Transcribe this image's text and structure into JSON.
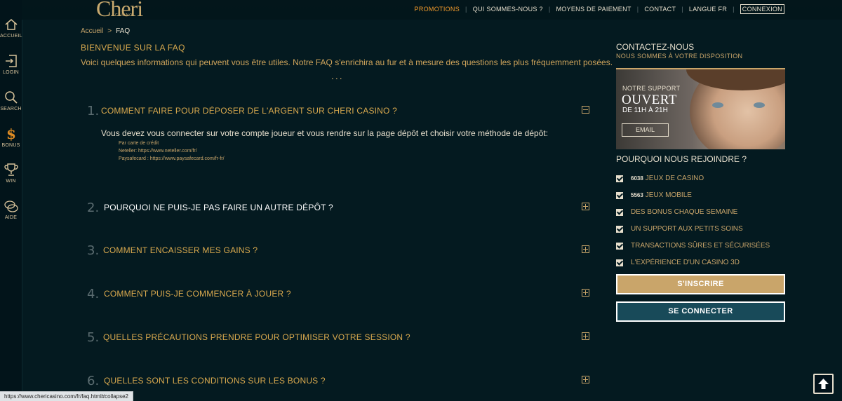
{
  "leftnav": [
    {
      "label": "ACCUEIL",
      "icon": "home-icon"
    },
    {
      "label": "LOGIN",
      "icon": "login-icon"
    },
    {
      "label": "SEARCH",
      "icon": "search-icon"
    },
    {
      "label": "BONUS",
      "icon": "dollar-icon"
    },
    {
      "label": "WIN",
      "icon": "trophy-icon"
    },
    {
      "label": "AIDE",
      "icon": "chat-bubbles-icon"
    }
  ],
  "brand": {
    "name": "Cheri",
    "sub": "CASINO"
  },
  "topnav": {
    "promotions": "PROMOTIONS",
    "about": "QUI SOMMES-NOUS ?",
    "payment": "MOYENS DE PAIEMENT",
    "contact": "CONTACT",
    "language": "LANGUE FR",
    "login": "CONNEXION"
  },
  "breadcrumb": {
    "home": "Accueil",
    "separator": ">",
    "current": "FAQ"
  },
  "intro": {
    "title": "BIENVENUE SUR LA FAQ",
    "text": "Voici quelques informations qui peuvent vous être utiles. Notre FAQ s'enrichira au fur et à mesure des questions les plus fréquemment posées.",
    "dots": "..."
  },
  "faq": [
    {
      "num": "1.",
      "question": "COMMENT FAIRE POUR DÉPOSER DE L'ARGENT SUR CHERI CASINO ?",
      "expanded": true
    },
    {
      "num": "2.",
      "question": "POURQUOI NE PUIS-JE PAS FAIRE UN AUTRE DÉPÔT ?",
      "expanded": false
    },
    {
      "num": "3.",
      "question": "COMMENT ENCAISSER MES GAINS ?",
      "expanded": false
    },
    {
      "num": "4.",
      "question": "COMMENT PUIS-JE COMMENCER À JOUER ?",
      "expanded": false
    },
    {
      "num": "5.",
      "question": "QUELLES PRÉCAUTIONS PRENDRE POUR OPTIMISER VOTRE SESSION ?",
      "expanded": false
    },
    {
      "num": "6.",
      "question": "QUELLES SONT LES CONDITIONS SUR LES BONUS ?",
      "expanded": false
    }
  ],
  "answer1": {
    "intro": "Vous devez vous connecter sur votre compte joueur et vous rendre sur la page dépôt et choisir votre méthode de dépôt:",
    "options": [
      "Par carte de crédit",
      "Neteller: https://www.neteller.com/fr/",
      "Paysafecard : https://www.paysafecard.com/fr-fr/"
    ]
  },
  "contact": {
    "title": "CONTACTEZ-NOUS",
    "subtitle": "NOUS SOMMES À VOTRE DISPOSITION",
    "support_label": "NOTRE SUPPORT",
    "status": "OUVERT",
    "hours": "DE 11H À 21H",
    "email_button": "EMAIL"
  },
  "why": {
    "title": "POURQUOI NOUS REJOINDRE ?",
    "items": [
      {
        "count": "6038",
        "text": "JEUX DE CASINO"
      },
      {
        "count": "5563",
        "text": "JEUX MOBILE"
      },
      {
        "count": "",
        "text": "DES BONUS CHAQUE SEMAINE"
      },
      {
        "count": "",
        "text": "UN SUPPORT AUX PETITS SOINS"
      },
      {
        "count": "",
        "text": "TRANSACTIONS SÛRES ET SÉCURISÉES"
      },
      {
        "count": "",
        "text": "L'EXPÉRIENCE D'UN CASINO 3D"
      }
    ]
  },
  "buttons": {
    "signup": "S'INSCRIRE",
    "login": "SE CONNECTER"
  },
  "status_url": "https://www.chericasino.com/fr/faq.html#collapse2",
  "colors": {
    "gold": "#c9a56a",
    "orange": "#f29a2b",
    "background": "#041a20",
    "teal": "#184a59"
  }
}
